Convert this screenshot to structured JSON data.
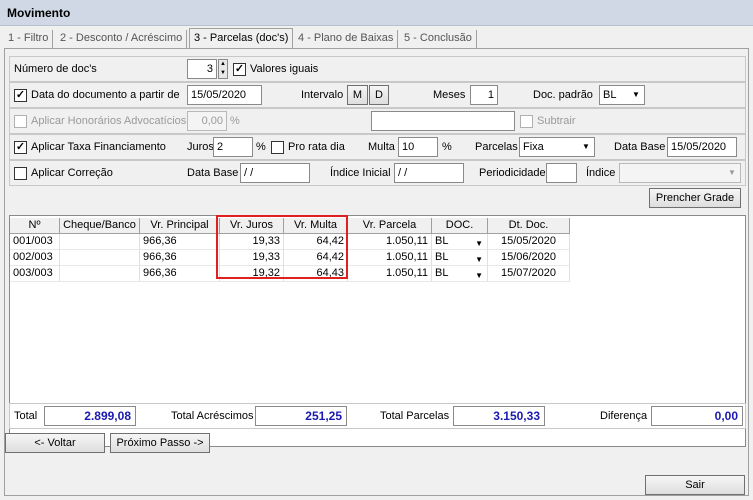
{
  "window": {
    "title": "Movimento"
  },
  "tabs": [
    {
      "label": "1 - Filtro"
    },
    {
      "label": "2 - Desconto / Acréscimo"
    },
    {
      "label": "3 - Parcelas (doc's)"
    },
    {
      "label": "4 - Plano de Baixas"
    },
    {
      "label": "5 - Conclusão"
    }
  ],
  "row1": {
    "num_docs_label": "Número de doc's",
    "num_docs_value": "3",
    "valores_iguais_label": "Valores iguais",
    "valores_iguais_checked": "✓"
  },
  "row2": {
    "data_doc_label": "Data do documento a partir de",
    "data_doc_checked": "✓",
    "data_doc_value": "15/05/2020",
    "intervalo_label": "Intervalo",
    "intervalo_m": "M",
    "intervalo_d": "D",
    "meses_label": "Meses",
    "meses_value": "1",
    "doc_padrao_label": "Doc. padrão",
    "doc_padrao_value": "BL"
  },
  "row3": {
    "honorarios_label": "Aplicar Honorários Advocatícios",
    "honorarios_value": "0,00",
    "percent": "%",
    "subtrair_label": "Subtrair"
  },
  "row4": {
    "taxa_label": "Aplicar Taxa Financiamento",
    "taxa_checked": "✓",
    "juros_label": "Juros",
    "juros_value": "2",
    "percent": "%",
    "pro_rata_label": "Pro rata dia",
    "multa_label": "Multa",
    "multa_value": "10",
    "parcelas_label": "Parcelas",
    "parcelas_value": "Fixa",
    "data_base_label": "Data Base",
    "data_base_value": "15/05/2020"
  },
  "row5": {
    "correcao_label": "Aplicar Correção",
    "data_base_label": "Data Base",
    "data_base_value": " / /",
    "indice_inicial_label": "Índice Inicial",
    "indice_inicial_value": " / /",
    "periodicidade_label": "Periodicidade",
    "indice_label": "Índice"
  },
  "prencher_grade_label": "Prencher Grade",
  "grid": {
    "headers": [
      "Nº",
      "Cheque/Banco",
      "Vr. Principal",
      "Vr. Juros",
      "Vr. Multa",
      "Vr. Parcela",
      "DOC.",
      "Dt. Doc."
    ],
    "rows": [
      {
        "num": "001/003",
        "cheque": "",
        "principal": "966,36",
        "juros": "19,33",
        "multa": "64,42",
        "parcela": "1.050,11",
        "doc": "BL",
        "dt": "15/05/2020"
      },
      {
        "num": "002/003",
        "cheque": "",
        "principal": "966,36",
        "juros": "19,33",
        "multa": "64,42",
        "parcela": "1.050,11",
        "doc": "BL",
        "dt": "15/06/2020"
      },
      {
        "num": "003/003",
        "cheque": "",
        "principal": "966,36",
        "juros": "19,32",
        "multa": "64,43",
        "parcela": "1.050,11",
        "doc": "BL",
        "dt": "15/07/2020"
      }
    ]
  },
  "totals": {
    "total_label": "Total",
    "total_value": "2.899,08",
    "acrescimos_label": "Total Acréscimos",
    "acrescimos_value": "251,25",
    "parcelas_label": "Total Parcelas",
    "parcelas_value": "3.150,33",
    "diferenca_label": "Diferença",
    "diferenca_value": "0,00"
  },
  "buttons": {
    "voltar": "<- Voltar",
    "proximo": "Próximo Passo ->",
    "sair": "Sair"
  },
  "colors": {
    "highlight": "#e02020",
    "total_text": "#1a1ab0"
  }
}
